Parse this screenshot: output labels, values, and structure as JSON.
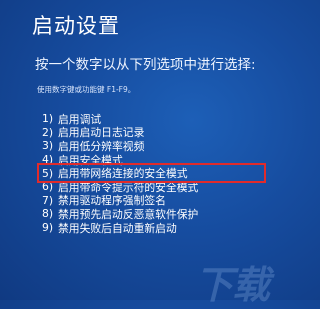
{
  "screen": {
    "title": "启动设置",
    "subtitle": "按一个数字以从下列选项中进行选择:",
    "hint": "使用数字键或功能键 F1-F9。",
    "highlight_color": "#e12b2b",
    "background_color": "#164c9f"
  },
  "options": [
    {
      "num": "1)",
      "label": "启用调试"
    },
    {
      "num": "2)",
      "label": "启用启动日志记录"
    },
    {
      "num": "3)",
      "label": "启用低分辨率视频"
    },
    {
      "num": "4)",
      "label": "启用安全模式"
    },
    {
      "num": "5)",
      "label": "启用带网络连接的安全模式",
      "highlighted": true
    },
    {
      "num": "6)",
      "label": "启用带命令提示符的安全模式"
    },
    {
      "num": "7)",
      "label": "禁用驱动程序强制签名"
    },
    {
      "num": "8)",
      "label": "禁用预先启动反恶意软件保护"
    },
    {
      "num": "9)",
      "label": "禁用失败后自动重新启动"
    }
  ],
  "watermark": "下载"
}
